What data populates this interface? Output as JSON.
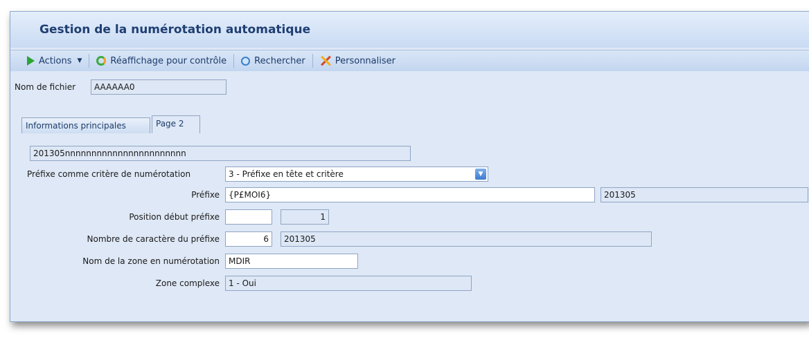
{
  "window": {
    "title": "Gestion de la numérotation automatique"
  },
  "toolbar": {
    "actions": "Actions",
    "refresh": "Réaffichage pour contrôle",
    "search": "Rechercher",
    "customize": "Personnaliser"
  },
  "file": {
    "label": "Nom de fichier",
    "value": "AAAAAA0"
  },
  "tabs": [
    {
      "label": "Informations principales"
    },
    {
      "label": "Page 2"
    }
  ],
  "page2": {
    "pattern": "201305nnnnnnnnnnnnnnnnnnnnnnn",
    "prefix_criterion": {
      "label": "Préfixe comme critère de numérotation",
      "value": "3 - Préfixe en tête et critère"
    },
    "prefix": {
      "label": "Préfixe",
      "value": "{P£MOI6}",
      "computed": "201305"
    },
    "prefix_start": {
      "label": "Position début préfixe",
      "value": "",
      "computed": "1"
    },
    "prefix_length": {
      "label": "Nombre de caractère du préfixe",
      "value": "6",
      "computed": "201305"
    },
    "zone_name": {
      "label": "Nom de la zone en numérotation",
      "value": "MDIR"
    },
    "complex_zone": {
      "label": "Zone complexe",
      "value": "1 - Oui"
    }
  },
  "colors": {
    "background": "#dfe8f6",
    "title": "#1f3f73",
    "border": "#8ea4c4"
  },
  "icons": [
    "play-icon",
    "refresh-icon",
    "search-icon",
    "tools-icon",
    "dropdown-arrow-icon"
  ]
}
